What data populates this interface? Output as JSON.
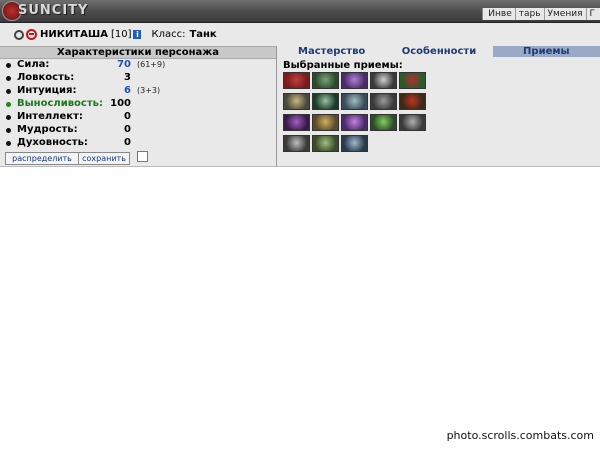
{
  "header": {
    "logo_text": "SUNCITY",
    "menu": [
      "Инве",
      "тарь",
      "Умения",
      "Г"
    ]
  },
  "character": {
    "name": "НИКИТАША",
    "level": "[10]",
    "info_icon": "i",
    "class_label": "Класс:",
    "class_value": "Танк"
  },
  "stats": {
    "header": "Характеристики персонажа",
    "rows": [
      {
        "label": "Сила:",
        "value": "70",
        "extra": "(61+9)"
      },
      {
        "label": "Ловкость:",
        "value": "3",
        "extra": ""
      },
      {
        "label": "Интуиция:",
        "value": "6",
        "extra": "(3+3)"
      },
      {
        "label": "Выносливость:",
        "value": "100",
        "extra": ""
      },
      {
        "label": "Интеллект:",
        "value": "0",
        "extra": ""
      },
      {
        "label": "Мудрость:",
        "value": "0",
        "extra": ""
      },
      {
        "label": "Духовность:",
        "value": "0",
        "extra": ""
      }
    ],
    "distribute_button": "распределить",
    "save_button": "сохранить"
  },
  "tabs": [
    "Мастерство",
    "Особенности",
    "Приемы"
  ],
  "active_tab": "Приемы",
  "skills": {
    "title": "Выбранные приемы:",
    "icons": [
      [
        "blood-slash-icon",
        "monster-icon",
        "blade-icon",
        "star-burst-icon",
        "fist-icon"
      ],
      [
        "shield-icon",
        "skull-icon",
        "shield-ring-icon",
        "wolf-icon",
        "red-shield-icon"
      ],
      [
        "purple-cloak-icon",
        "hammer-icon",
        "claw-icon",
        "green-hand-icon",
        "dagger-icon"
      ],
      [
        "swords-icon",
        "scroll-icon",
        "wings-icon"
      ]
    ]
  },
  "colors": {
    "accent_blue": "#1e50b4",
    "highlight_green": "#1a7a1a",
    "active_tab_bg": "#9aaac4"
  },
  "watermark": "photo.scrolls.combats.com"
}
